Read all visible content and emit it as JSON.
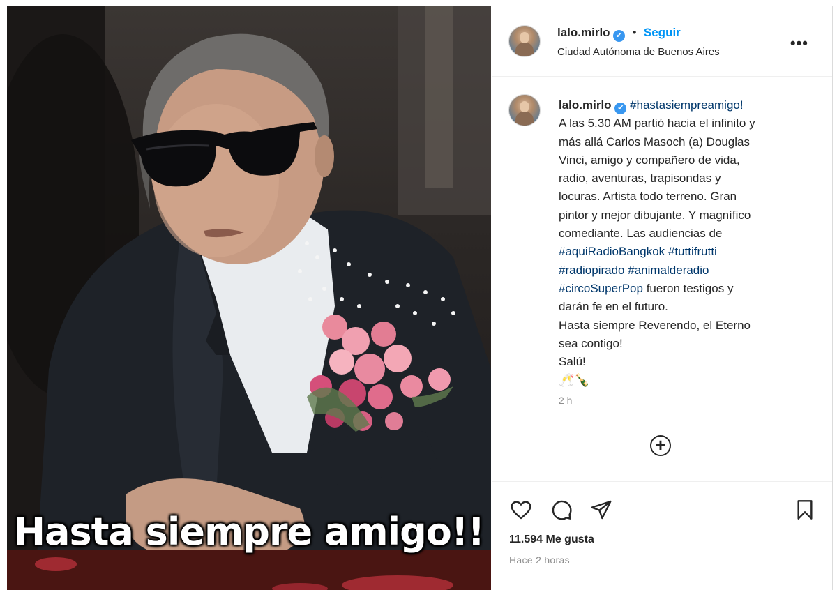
{
  "photo": {
    "overlay_text": "Hasta siempre amigo!!"
  },
  "header": {
    "username": "lalo.mirlo",
    "verified": true,
    "separator": "•",
    "follow_label": "Seguir",
    "location": "Ciudad Autónoma de Buenos Aires",
    "more_label": "•••"
  },
  "caption": {
    "username": "lalo.mirlo",
    "hashtag_title": "#hastasiempreamigo!",
    "line_1": "A las 5.30 AM partió hacia el infinito y",
    "line_2": "más allá Carlos Masoch (a) Douglas",
    "line_3": "Vinci, amigo y compañero de vida,",
    "line_4": "radio, aventuras, trapisondas y",
    "line_5": "locuras. Artista todo terreno. Gran",
    "line_6": "pintor y mejor dibujante. Y magnífico",
    "line_7": "comediante. Las audiencias de",
    "tag_1": "#aquiRadioBangkok",
    "tag_2": "#tuttifrutti",
    "tag_3": "#radiopirado",
    "tag_4": "#animalderadio",
    "tag_5": "#circoSuperPop",
    "line_8": "fueron testigos y",
    "line_9": "darán fe en el futuro.",
    "line_10": "Hasta siempre Reverendo, el Eterno",
    "line_11": "sea contigo!",
    "line_12": "Salú!",
    "emojis": "🥂🍾",
    "time": "2 h"
  },
  "actions": {
    "load_more_icon": "plus-circle-icon",
    "like_icon": "heart-icon",
    "comment_icon": "comment-icon",
    "share_icon": "paper-plane-icon",
    "save_icon": "bookmark-icon"
  },
  "stats": {
    "likes": "11.594 Me gusta",
    "posted_ago": "Hace 2 horas"
  },
  "colors": {
    "accent": "#0095f6",
    "verified": "#3897f0",
    "hashtag": "#00376b",
    "muted": "#8e8e8e"
  }
}
